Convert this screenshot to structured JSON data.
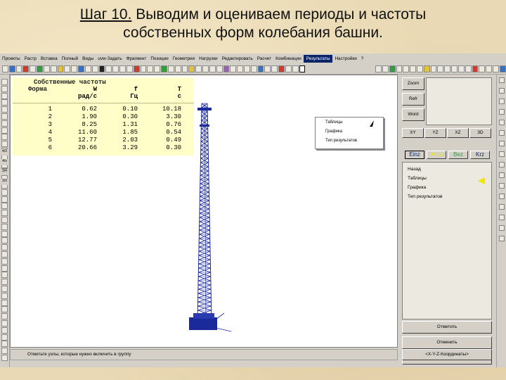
{
  "slide": {
    "title_step": "Шаг 10.",
    "title_rest": " Выводим и оцениваем периоды и частоты",
    "title_line2": "собственных форм колебания башни."
  },
  "menu": {
    "items": [
      "Проекты",
      "Растр",
      "Вставка",
      "Полный",
      "Виды",
      "uvw-Задать",
      "Фрагмент",
      "Позиции",
      "Геометрия",
      "Нагрузки",
      "Редактировать",
      "Расчет",
      "Комбинации",
      "Результаты",
      "Настройки",
      "?"
    ],
    "active": "Результаты"
  },
  "dropdown": {
    "items": [
      "Таблицы",
      "Графика",
      "Тип результатов"
    ]
  },
  "freq_table": {
    "title": "Собственные частоты",
    "col1": "Форма",
    "col2": "W",
    "col2_unit": "рад/с",
    "col3": "f",
    "col3_unit": "Гц",
    "col4": "T",
    "col4_unit": "с",
    "rows": [
      [
        "1",
        "0.62",
        "0.10",
        "10.18"
      ],
      [
        "2",
        "1.90",
        "0.30",
        "3.30"
      ],
      [
        "3",
        "8.25",
        "1.31",
        "0.76"
      ],
      [
        "4",
        "11.60",
        "1.85",
        "0.54"
      ],
      [
        "5",
        "12.77",
        "2.03",
        "0.49"
      ],
      [
        "6",
        "20.66",
        "3.29",
        "0.30"
      ]
    ]
  },
  "left_toolbar": {
    "labels": [
      "4/3",
      "4/x",
      "3/4",
      "3/3"
    ]
  },
  "right_panel": {
    "buttons_top": [
      "Zoom",
      "Refr",
      "Word"
    ],
    "views": [
      "XY",
      "YZ",
      "XZ",
      "3D"
    ],
    "tabs": [
      "Einz",
      "Auto",
      "Bez",
      "Krz"
    ],
    "list": [
      "Назад",
      "Таблицы",
      "Графика",
      "Тип результатов"
    ],
    "actions": [
      "Отметить",
      "Отменить",
      "Вывести"
    ],
    "coord": "<X-Y-Z-Координаты>"
  },
  "status": {
    "text": "Отметьте узлы, которые нужно включить в группу"
  },
  "colors": {
    "tower": "#1a2a9a",
    "table_bg": "#fffec8",
    "menu_highlight": "#0a246a",
    "yellow_marker": "#f2e600"
  }
}
